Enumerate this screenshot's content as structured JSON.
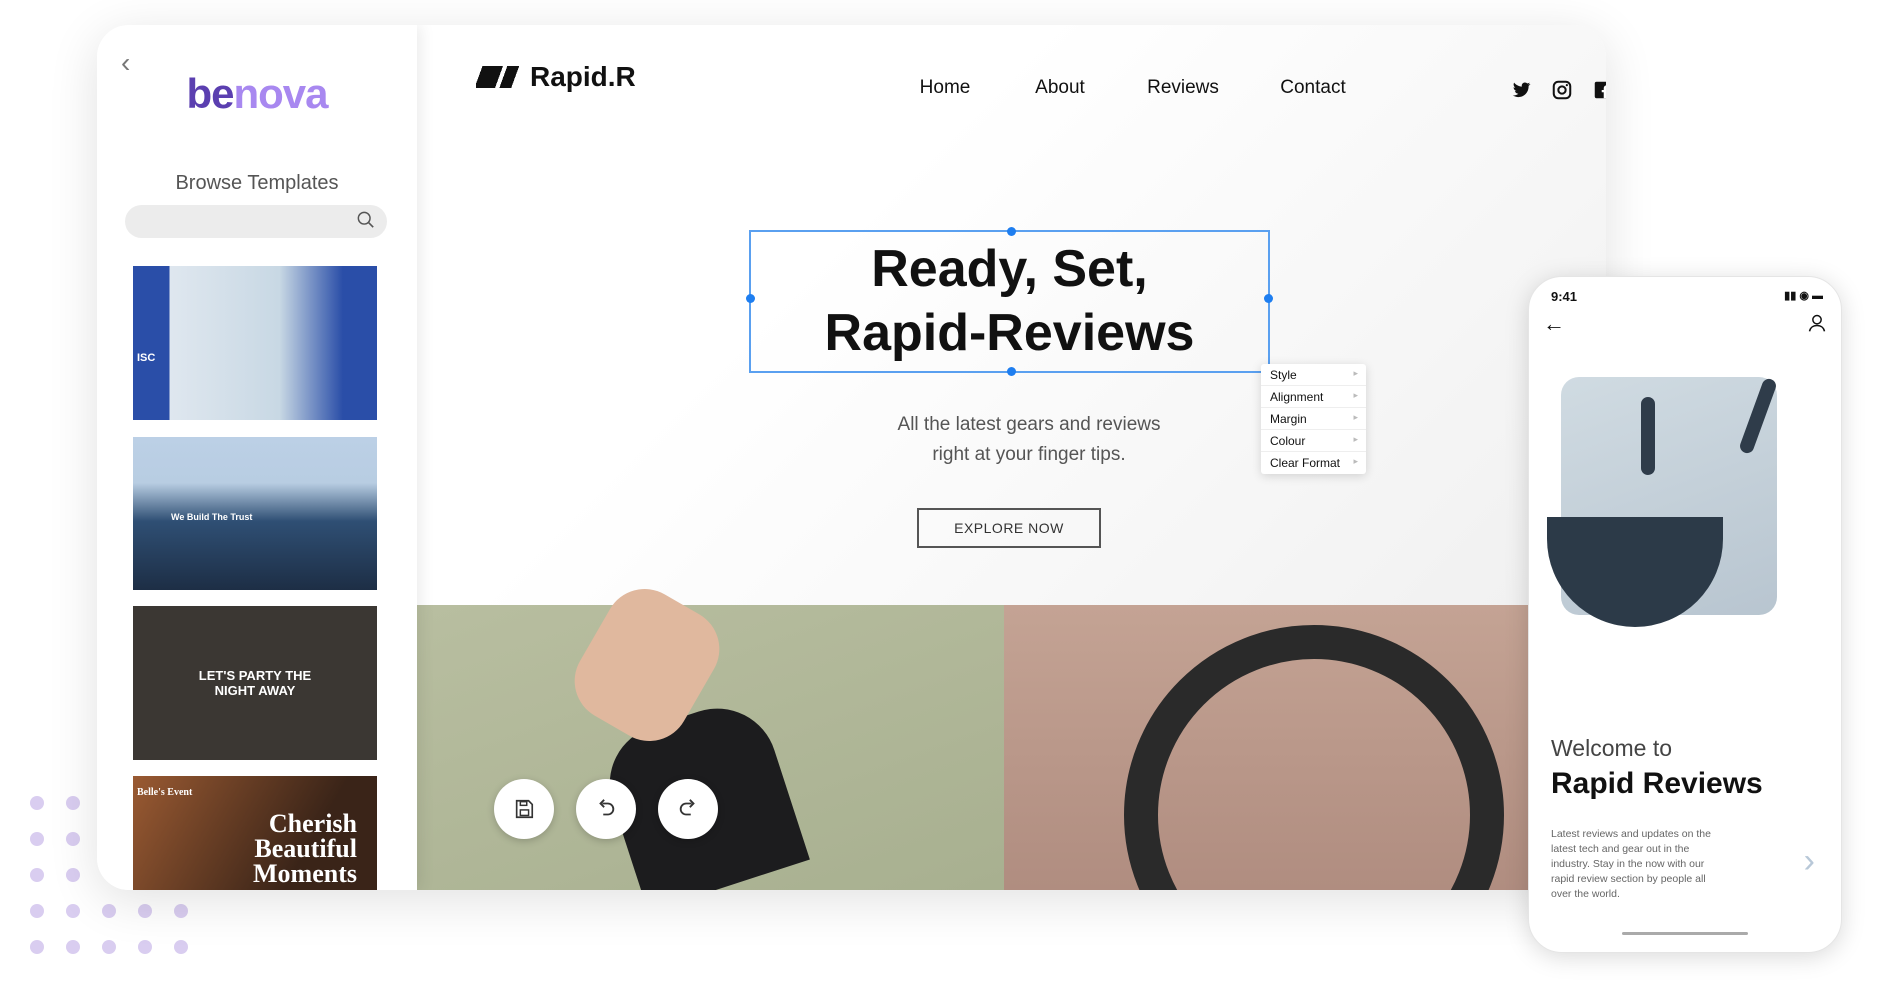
{
  "sidebar": {
    "logo_part1": "be",
    "logo_part2": "nova",
    "title": "Browse Templates",
    "search_placeholder": "",
    "templates": [
      {
        "label": "ISC"
      },
      {
        "label": "We Build The Trust"
      },
      {
        "label": "LET'S PARTY THE NIGHT AWAY"
      },
      {
        "label": "Cherish Beautiful Moments",
        "brand": "Belle's Event"
      }
    ]
  },
  "site": {
    "brand": "Rapid.R",
    "nav": [
      "Home",
      "About",
      "Reviews",
      "Contact"
    ],
    "social_icons": [
      "twitter-icon",
      "instagram-icon",
      "facebook-icon",
      "search-icon"
    ],
    "hero_line1": "Ready, Set,",
    "hero_line2": "Rapid-Reviews",
    "sub_line1": "All the latest gears and reviews",
    "sub_line2": "right at your finger tips.",
    "cta": "EXPLORE NOW"
  },
  "context_menu": [
    "Style",
    "Alignment",
    "Margin",
    "Colour",
    "Clear Format"
  ],
  "tools": [
    "save-icon",
    "undo-icon",
    "redo-icon"
  ],
  "phone": {
    "time": "9:41",
    "welcome": "Welcome to",
    "title": "Rapid Reviews",
    "description": "Latest reviews and updates on the latest tech and gear out in the industry. Stay in the now with our rapid review section by people all over the world."
  },
  "colors": {
    "accent": "#1e7ef0",
    "brand_dark": "#5b3fb0",
    "brand_light": "#a888f0"
  }
}
